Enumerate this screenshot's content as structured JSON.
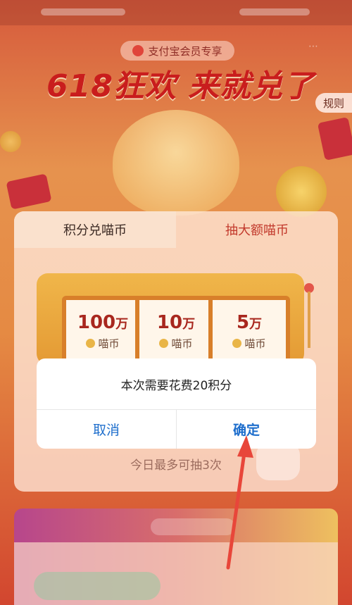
{
  "status_bar": {},
  "header": {
    "member_badge": "支付宝会员专享",
    "hero_title": "618狂欢 来就兑了",
    "rules_label": "规则"
  },
  "tabs": [
    {
      "label": "积分兑喵币"
    },
    {
      "label": "抽大额喵币"
    }
  ],
  "slot_machine": {
    "reels": [
      {
        "amount": "100",
        "unit": "万",
        "currency": "喵币"
      },
      {
        "amount": "10",
        "unit": "万",
        "currency": "喵币"
      },
      {
        "amount": "5",
        "unit": "万",
        "currency": "喵币"
      }
    ]
  },
  "daily_limit": "今日最多可抽3次",
  "dialog": {
    "message": "本次需要花费20积分",
    "cancel_label": "取消",
    "confirm_label": "确定"
  },
  "colors": {
    "accent_red": "#c91d1d",
    "dialog_button_blue": "#1e6ecc",
    "annotation_arrow": "#e8463a"
  }
}
